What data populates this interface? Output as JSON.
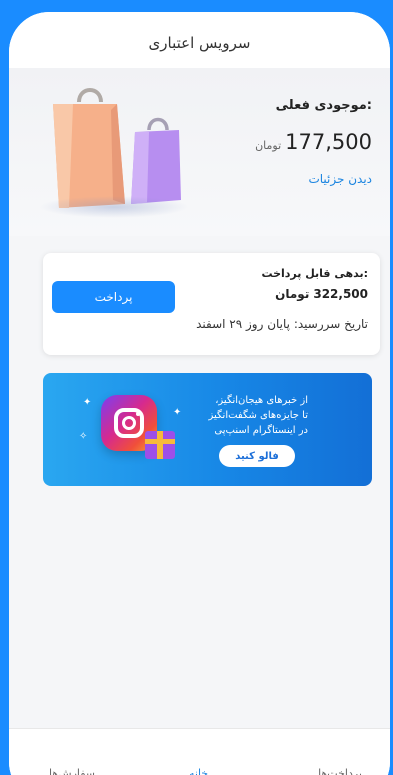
{
  "header": {
    "title": "سرویس اعتباری"
  },
  "balance": {
    "label": "موجودی فعلی:",
    "amount": "177,500",
    "unit": "تومان",
    "details_link": "دیدن جزئیات"
  },
  "debt": {
    "label": "بدهی قابل پرداخت:",
    "amount": "322,500",
    "unit": "تومان",
    "due_date": "تاریخ سررسید: پایان روز ۲۹ اسفند",
    "pay_button": "پرداخت"
  },
  "banner": {
    "line1": "از خبرهای هیجان‌انگیز،",
    "line2": "تا جایزه‌های شگفت‌انگیز",
    "line3": "در اینستاگرام اسنپ‌پی",
    "follow_button": "فالو کنید"
  },
  "bottom_nav": [
    {
      "label": "پرداخت‌ها",
      "icon": "wallet-icon"
    },
    {
      "label": "خانه",
      "icon": "home-icon",
      "active": true
    },
    {
      "label": "سفارش‌ها",
      "icon": "orders-icon"
    }
  ],
  "colors": {
    "accent": "#1a8cff",
    "link": "#1a84e0",
    "background": "#1a8cff"
  }
}
